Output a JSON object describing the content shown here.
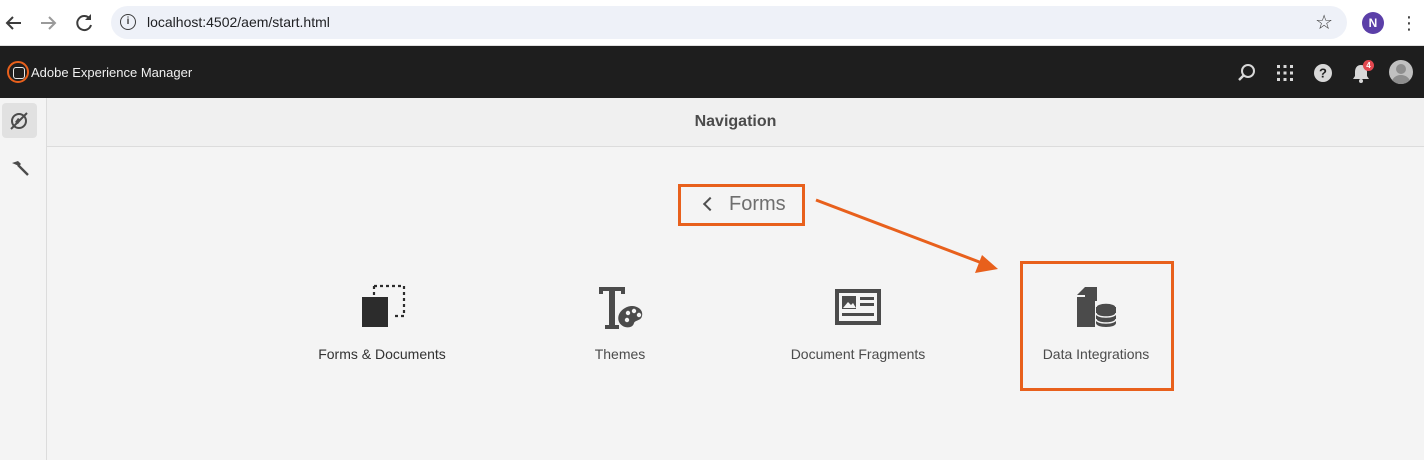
{
  "browser": {
    "url": "localhost:4502/aem/start.html",
    "profile_initial": "N"
  },
  "header": {
    "app_title": "Adobe Experience Manager",
    "notification_count": "4"
  },
  "navigation": {
    "title": "Navigation",
    "back_label": "Forms",
    "tiles": [
      {
        "label": "Forms & Documents",
        "icon": "forms-documents-icon"
      },
      {
        "label": "Themes",
        "icon": "themes-icon"
      },
      {
        "label": "Document Fragments",
        "icon": "document-fragments-icon"
      },
      {
        "label": "Data Integrations",
        "icon": "data-integrations-icon"
      }
    ]
  },
  "annotation": {
    "highlight_color": "#e8601c"
  }
}
